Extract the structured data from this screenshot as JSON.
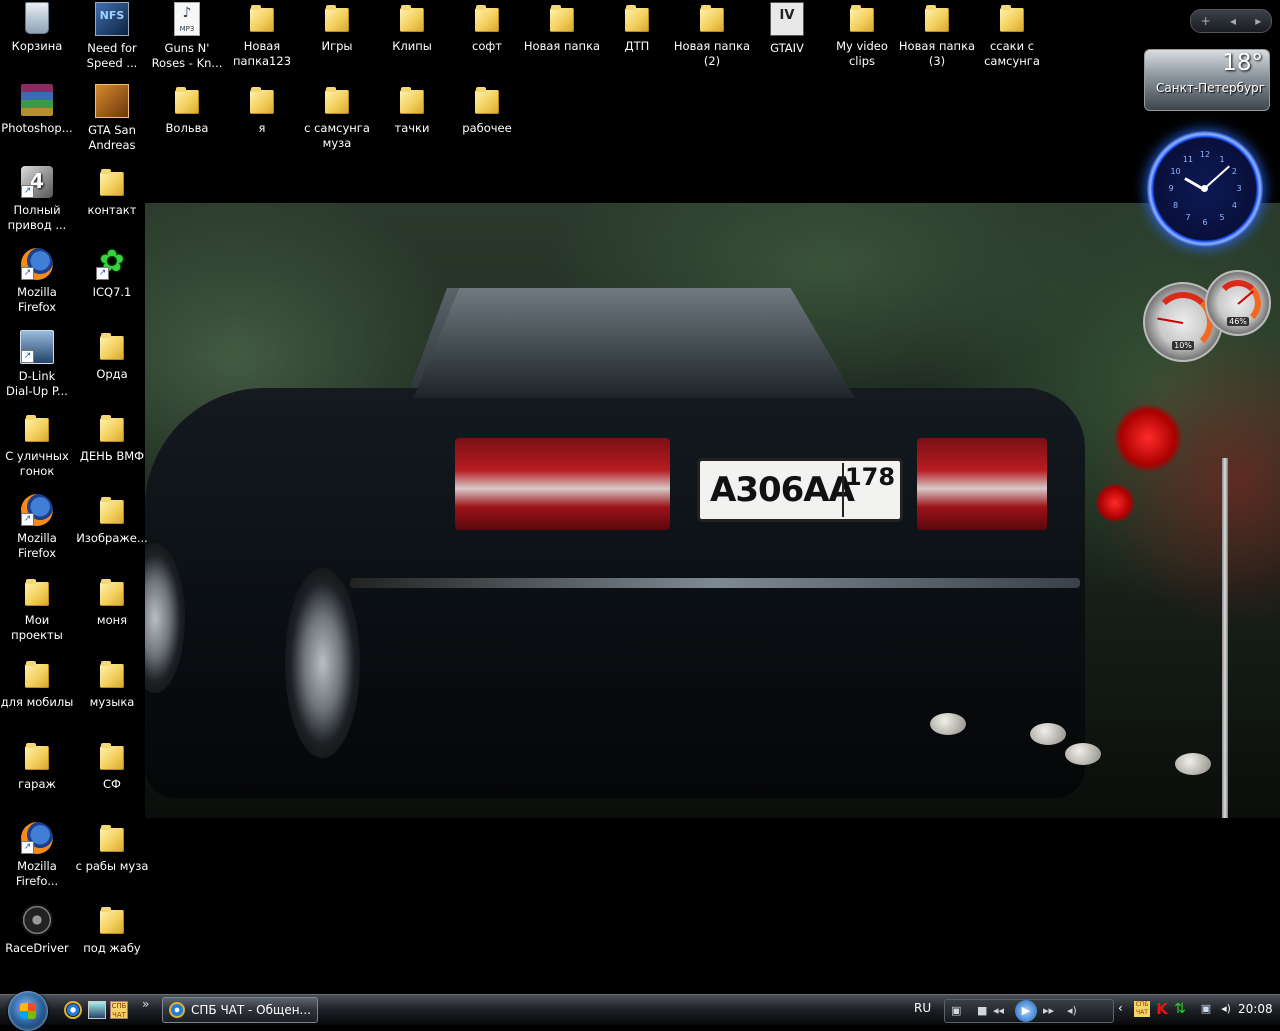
{
  "desktop": {
    "icons": [
      {
        "label": "Корзина",
        "icon": "recycle-bin-icon"
      },
      {
        "label": "Need for\nSpeed ...",
        "icon": "nfs-icon",
        "badge": "NFS"
      },
      {
        "label": "Guns N'\nRoses - Kn...",
        "icon": "mp3-file-icon",
        "badge": "MP3"
      },
      {
        "label": "Новая\nпапка123",
        "icon": "folder-icon"
      },
      {
        "label": "Игры",
        "icon": "folder-icon"
      },
      {
        "label": "Клипы",
        "icon": "folder-icon"
      },
      {
        "label": "софт",
        "icon": "folder-icon"
      },
      {
        "label": "Новая папка",
        "icon": "folder-icon"
      },
      {
        "label": "ДТП",
        "icon": "folder-icon"
      },
      {
        "label": "Новая папка\n(2)",
        "icon": "folder-icon"
      },
      {
        "label": "GTAIV",
        "icon": "gtaiv-icon",
        "badge": "IV"
      },
      {
        "label": "My video\nclips",
        "icon": "folder-icon"
      },
      {
        "label": "Новая папка\n(3)",
        "icon": "folder-icon"
      },
      {
        "label": "ссаки с\nсамсунга",
        "icon": "folder-icon"
      },
      {
        "label": "Photoshop...",
        "icon": "winrar-icon"
      },
      {
        "label": "GTA San\nAndreas",
        "icon": "gta-san-andreas-icon"
      },
      {
        "label": "Вольва",
        "icon": "folder-icon"
      },
      {
        "label": "я",
        "icon": "folder-icon"
      },
      {
        "label": "с самсунга\nмуза",
        "icon": "folder-icon"
      },
      {
        "label": "тачки",
        "icon": "folder-icon"
      },
      {
        "label": "рабочее",
        "icon": "folder-icon"
      },
      {
        "label": "Полный\nпривод ...",
        "icon": "4x4-icon",
        "badge": "4"
      },
      {
        "label": "контакт",
        "icon": "folder-icon"
      },
      {
        "label": "Mozilla\nFirefox",
        "icon": "firefox-icon"
      },
      {
        "label": "ICQ7.1",
        "icon": "icq-icon",
        "badge": "✿"
      },
      {
        "label": "D-Link\nDial-Up P...",
        "icon": "dlink-icon"
      },
      {
        "label": "Орда",
        "icon": "folder-icon"
      },
      {
        "label": "С уличных\nгонок",
        "icon": "folder-icon"
      },
      {
        "label": "ДЕНЬ ВМФ",
        "icon": "folder-icon"
      },
      {
        "label": "Mozilla\nFirefox",
        "icon": "firefox-icon"
      },
      {
        "label": "Изображе...",
        "icon": "folder-icon"
      },
      {
        "label": "Мои\nпроекты",
        "icon": "folder-icon"
      },
      {
        "label": "моня",
        "icon": "folder-icon"
      },
      {
        "label": "для мобилы",
        "icon": "folder-icon"
      },
      {
        "label": "музыка",
        "icon": "folder-icon"
      },
      {
        "label": "гараж",
        "icon": "folder-icon"
      },
      {
        "label": "СФ",
        "icon": "folder-icon"
      },
      {
        "label": "Mozilla\nFirefo...",
        "icon": "firefox-icon"
      },
      {
        "label": "с рабы муза",
        "icon": "folder-icon"
      },
      {
        "label": "RaceDriver",
        "icon": "racedriver-icon"
      },
      {
        "label": "под жабу",
        "icon": "folder-icon"
      }
    ]
  },
  "wallpaper": {
    "plate_number": "А306АА",
    "plate_region": "178"
  },
  "sidebar": {
    "add_label": "+",
    "prev_label": "◂",
    "next_label": "▸",
    "weather": {
      "temperature": "18°",
      "city": "Санкт-Петербург"
    },
    "clock_numbers": [
      "12",
      "1",
      "2",
      "3",
      "4",
      "5",
      "6",
      "7",
      "8",
      "9",
      "10",
      "11"
    ],
    "cpu_meter": {
      "cpu": "10%",
      "memory": "46%",
      "cpu_fraction": 0.1,
      "memory_fraction": 0.46
    }
  },
  "taskbar": {
    "quick_launch": {
      "spb_label": "СПБ\nЧАТ",
      "more": "»"
    },
    "active_window": "СПБ ЧАТ - Общен...",
    "language": "RU",
    "player": {
      "stop": "■",
      "prev": "◂◂",
      "play": "▶",
      "next": "▸▸",
      "volume": "◂)"
    },
    "tray": {
      "arrow": "‹",
      "spb_label": "СПБ\nЧАТ",
      "kaspersky": "K",
      "sync": "⇅",
      "network": "▣",
      "volume": "◂)"
    },
    "clock": "20:08"
  }
}
